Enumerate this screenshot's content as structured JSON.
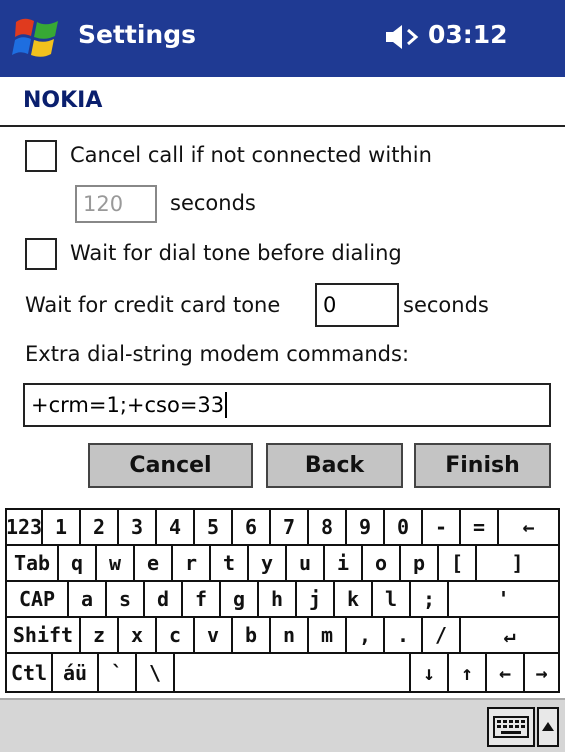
{
  "titlebar": {
    "title": "Settings",
    "time": "03:12"
  },
  "heading": "NOKIA",
  "form": {
    "cancel_call_label": "Cancel call if not connected within",
    "timeout_value": "120",
    "seconds_label": "seconds",
    "dial_tone_label": "Wait for dial tone before dialing",
    "credit_card_label": "Wait for credit card tone",
    "credit_card_value": "0",
    "credit_card_seconds_label": "seconds",
    "extra_commands_label": "Extra dial-string modem commands:",
    "extra_commands_value": "+crm=1;+cso=33"
  },
  "buttons": {
    "cancel": "Cancel",
    "back": "Back",
    "finish": "Finish"
  },
  "keyboard": {
    "row1": [
      "123",
      "1",
      "2",
      "3",
      "4",
      "5",
      "6",
      "7",
      "8",
      "9",
      "0",
      "-",
      "=",
      "←"
    ],
    "row2": [
      "Tab",
      "q",
      "w",
      "e",
      "r",
      "t",
      "y",
      "u",
      "i",
      "o",
      "p",
      "[",
      "]"
    ],
    "row3": [
      "CAP",
      "a",
      "s",
      "d",
      "f",
      "g",
      "h",
      "j",
      "k",
      "l",
      ";",
      "'"
    ],
    "row4": [
      "Shift",
      "z",
      "x",
      "c",
      "v",
      "b",
      "n",
      "m",
      ",",
      ".",
      "/",
      "↵"
    ],
    "row5": [
      "Ctl",
      "áü",
      "`",
      "\\",
      "",
      "↓",
      "↑",
      "←",
      "→"
    ]
  },
  "icons": {
    "start": "windows-flag-icon",
    "volume": "speaker-icon",
    "keyboard": "keyboard-icon",
    "input_menu": "up-arrow-icon"
  }
}
